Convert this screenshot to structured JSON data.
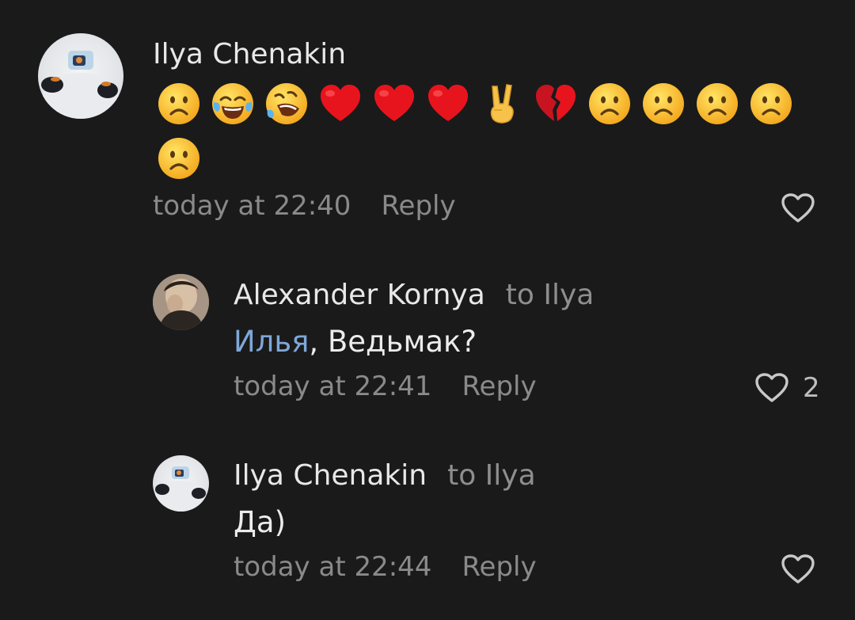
{
  "comments": [
    {
      "author": "Ilya Chenakin",
      "emojis": [
        "frowning-face",
        "tears-of-joy",
        "rolling-laughing",
        "red-heart",
        "red-heart",
        "red-heart",
        "victory-hand",
        "broken-heart",
        "frowning-face",
        "frowning-face",
        "frowning-face",
        "frowning-face",
        "frowning-face"
      ],
      "time": "today at 22:40",
      "reply_label": "Reply",
      "likes": ""
    },
    {
      "author": "Alexander Kornya",
      "to": "to Ilya",
      "mention": "Илья",
      "text": ", Ведьмак?",
      "time": "today at 22:41",
      "reply_label": "Reply",
      "likes": "2"
    },
    {
      "author": "Ilya Chenakin",
      "to": "to Ilya",
      "text": "Да)",
      "time": "today at 22:44",
      "reply_label": "Reply",
      "likes": ""
    }
  ],
  "colors": {
    "background": "#1a1a1a",
    "mention": "#7fa7d9",
    "muted": "#8a8a8a"
  }
}
